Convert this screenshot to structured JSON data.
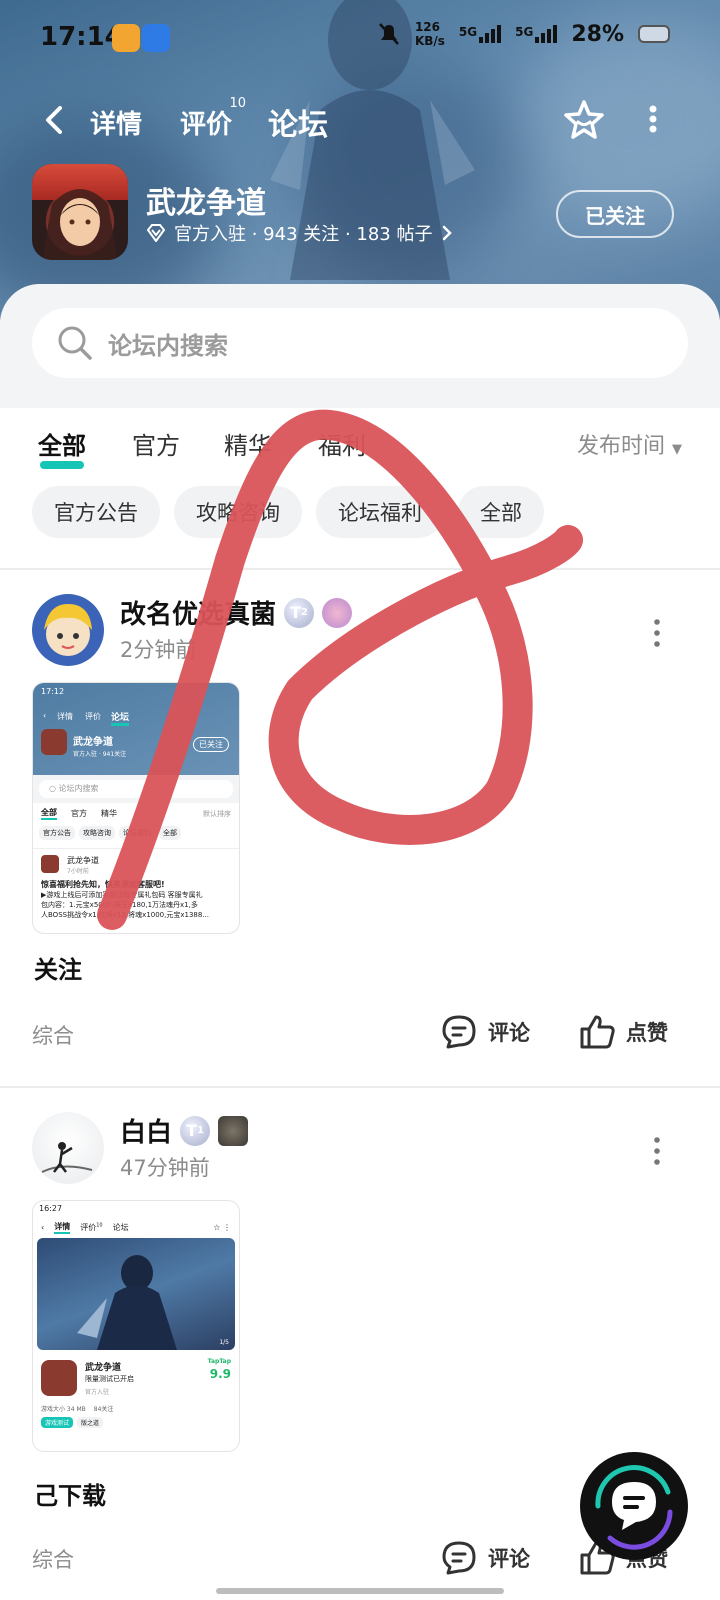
{
  "status": {
    "time": "17:14",
    "net_speed": "126",
    "net_unit": "KB/s",
    "sig1": "5G",
    "sig2": "5G",
    "battery": "28%"
  },
  "nav": {
    "tabs": [
      {
        "label": "详情"
      },
      {
        "label": "评价",
        "badge": "10"
      },
      {
        "label": "论坛"
      }
    ]
  },
  "game": {
    "name": "武龙争道",
    "meta": "官方入驻 · 943 关注 · 183 帖子",
    "follow_label": "已关注"
  },
  "search": {
    "placeholder": "论坛内搜索"
  },
  "filters": {
    "tabs": [
      "全部",
      "官方",
      "精华",
      "福利"
    ],
    "sort": "发布时间"
  },
  "chips": [
    "官方公告",
    "攻略咨询",
    "论坛福利",
    "全部"
  ],
  "posts": [
    {
      "author": "改名优选真菌",
      "level": "2",
      "time": "2分钟前",
      "title": "关注",
      "category": "综合",
      "comment_label": "评论",
      "like_label": "点赞",
      "thumb": {
        "time": "17:12",
        "tabs": [
          "详情",
          "评价",
          "论坛"
        ],
        "game": "武龙争道",
        "meta": "官方入驻 · 941关注",
        "follow": "已关注",
        "search": "论坛内搜索",
        "filters": [
          "全部",
          "官方",
          "精华"
        ],
        "sort": "默认排序",
        "chips": [
          "官方公告",
          "攻略咨询",
          "论坛福利",
          "全部"
        ],
        "post_author": "武龙争道",
        "post_time": "7小时前",
        "post_title": "惊喜福利抢先知，快来添加客服吧!",
        "post_body1": "▶游戏上线后可添加客服领取专属礼包码 客服专属礼",
        "post_body2": "包内容：1.元宝x5000,神玉x180,1万法魂丹x1,多",
        "post_body3": "人BOSS挑战令x1,红将x13,将魂x1000,元宝x1388..."
      }
    },
    {
      "author": "白白",
      "level": "1",
      "time": "47分钟前",
      "title": "己下载",
      "category": "综合",
      "comment_label": "评论",
      "like_label": "点赞",
      "thumb": {
        "time": "16:27",
        "tabs": [
          "详情",
          "评价",
          "论坛"
        ],
        "tab_badge": "10",
        "page_label": "1/5",
        "game": "武龙争道",
        "sub": "限量测试已开启",
        "meta": "官方入驻",
        "store": "TapTap",
        "score": "9.9",
        "size": "游戏大小 34 MB",
        "follow": "84关注",
        "tag1": "游戏测试",
        "tag2": "版之道"
      }
    }
  ],
  "colors": {
    "accent": "#15c5b5",
    "scribble": "#d95358"
  }
}
